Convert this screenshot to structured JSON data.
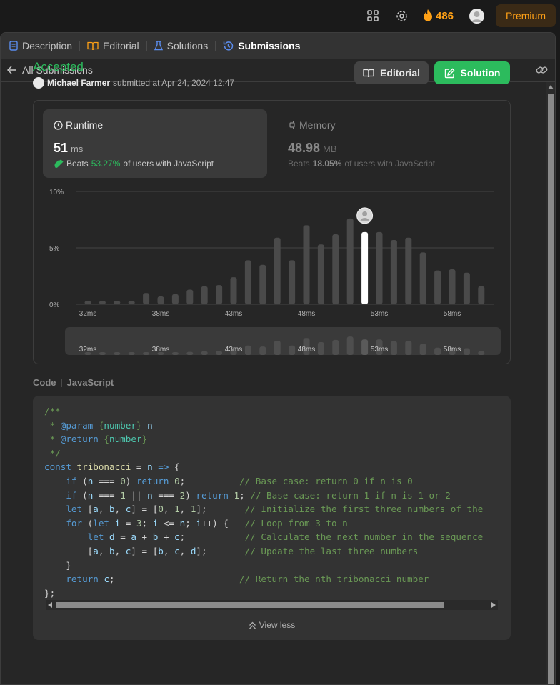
{
  "topbar": {
    "streak_count": "486",
    "premium_label": "Premium"
  },
  "tabs": [
    {
      "label": "Description"
    },
    {
      "label": "Editorial"
    },
    {
      "label": "Solutions"
    },
    {
      "label": "Submissions"
    }
  ],
  "subbar": {
    "back_label": "All Submissions"
  },
  "submission": {
    "status": "Accepted",
    "user": "Michael Farmer",
    "submitted_text": "submitted at Apr 24, 2024 12:47"
  },
  "buttons": {
    "editorial": "Editorial",
    "solution": "Solution"
  },
  "runtime": {
    "title": "Runtime",
    "value": "51",
    "unit": "ms",
    "beats_prefix": "Beats",
    "beats_pct": "53.27%",
    "beats_suffix": "of users with JavaScript"
  },
  "memory": {
    "title": "Memory",
    "value": "48.98",
    "unit": "MB",
    "beats_prefix": "Beats",
    "beats_pct": "18.05%",
    "beats_suffix": "of users with JavaScript"
  },
  "chart_data": {
    "type": "bar",
    "x": [
      32,
      33,
      34,
      35,
      36,
      37,
      38,
      39,
      40,
      41,
      42,
      43,
      44,
      45,
      46,
      47,
      48,
      49,
      50,
      51,
      52,
      53,
      54,
      55,
      56,
      57,
      58,
      59,
      60
    ],
    "values": [
      0.3,
      0.3,
      0.3,
      0.3,
      1.0,
      0.7,
      0.9,
      1.3,
      1.6,
      1.7,
      2.4,
      3.9,
      3.5,
      5.9,
      3.9,
      7.0,
      5.3,
      6.2,
      7.6,
      6.4,
      6.4,
      5.7,
      5.9,
      4.6,
      3.0,
      3.1,
      2.8,
      1.6,
      0
    ],
    "highlight_x": 51,
    "yticks": [
      "0%",
      "5%",
      "10%"
    ],
    "ylim": [
      0,
      10
    ],
    "xtick_labels": [
      "32ms",
      "38ms",
      "43ms",
      "48ms",
      "53ms",
      "58ms"
    ],
    "xtick_values": [
      32,
      37,
      42,
      47,
      52,
      57
    ]
  },
  "code": {
    "header_left": "Code",
    "header_right": "JavaScript",
    "view_less": "View less"
  },
  "colors": {
    "accepted": "#2cbb5d",
    "premium": "#ffa116"
  }
}
